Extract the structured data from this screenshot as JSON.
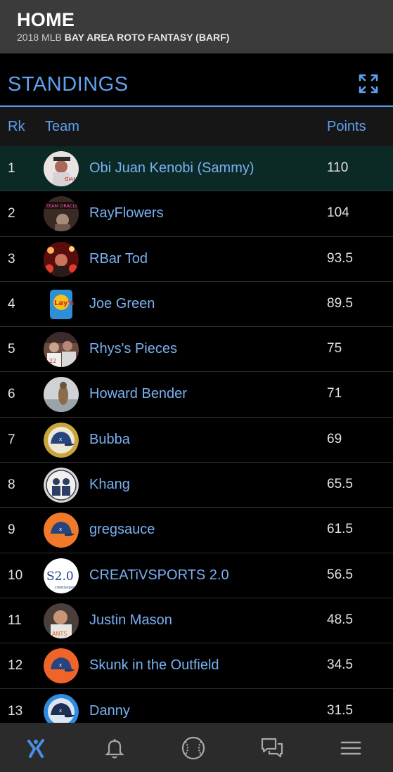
{
  "header": {
    "title": "HOME",
    "subtitle_prefix": "2018 MLB",
    "subtitle_league": "BAY AREA ROTO FANTASY (BARF)"
  },
  "standings": {
    "title": "STANDINGS",
    "columns": {
      "rank": "Rk",
      "team": "Team",
      "points": "Points"
    },
    "rows": [
      {
        "rank": "1",
        "team": "Obi Juan Kenobi (Sammy)",
        "points": "110"
      },
      {
        "rank": "2",
        "team": "RayFlowers",
        "points": "104"
      },
      {
        "rank": "3",
        "team": "RBar Tod",
        "points": "93.5"
      },
      {
        "rank": "4",
        "team": "Joe Green",
        "points": "89.5"
      },
      {
        "rank": "5",
        "team": "Rhys's Pieces",
        "points": "75"
      },
      {
        "rank": "6",
        "team": "Howard Bender",
        "points": "71"
      },
      {
        "rank": "7",
        "team": "Bubba",
        "points": "69"
      },
      {
        "rank": "8",
        "team": "Khang",
        "points": "65.5"
      },
      {
        "rank": "9",
        "team": "gregsauce",
        "points": "61.5"
      },
      {
        "rank": "10",
        "team": "CREATiVSPORTS 2.0",
        "points": "56.5"
      },
      {
        "rank": "11",
        "team": "Justin Mason",
        "points": "48.5"
      },
      {
        "rank": "12",
        "team": "Skunk in the Outfield",
        "points": "34.5"
      },
      {
        "rank": "13",
        "team": "Danny",
        "points": "31.5"
      }
    ]
  },
  "avatar_labels": {
    "team_oracle": "TEAM ORACLE",
    "lays": "Lay's",
    "creativ": "S2.0"
  },
  "icons": {
    "expand": "expand-icon",
    "home": "home-icon",
    "bell": "bell-icon",
    "baseball": "baseball-icon",
    "chat": "chat-icon",
    "menu": "menu-icon"
  },
  "colors": {
    "accent": "#5ea1f0",
    "highlight_row": "#0b2a26",
    "topbar": "#3b3b3b",
    "nav": "#2b2b2b"
  }
}
